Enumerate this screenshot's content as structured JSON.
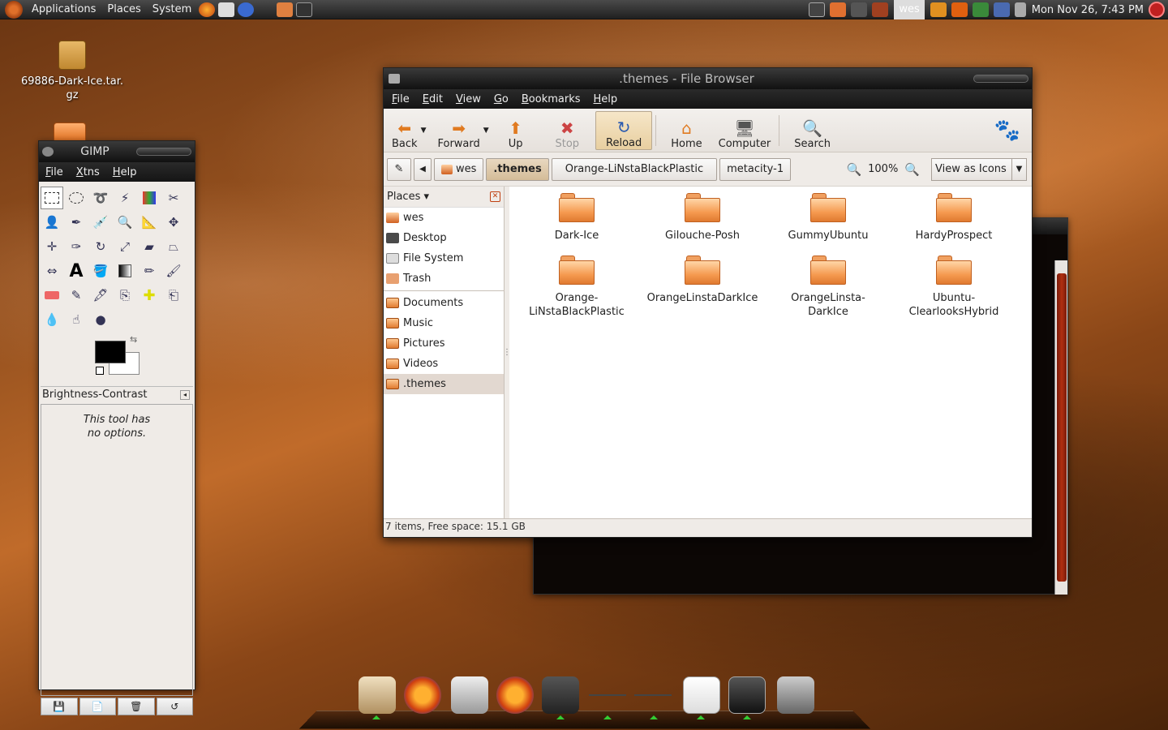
{
  "top_panel": {
    "menus": [
      "Applications",
      "Places",
      "System"
    ],
    "user": "wes",
    "clock": "Mon Nov 26,  7:43 PM"
  },
  "desktop": {
    "icons": [
      {
        "label": "69886-Dark-Ice.tar.\ngz"
      }
    ]
  },
  "gimp": {
    "title": "GIMP",
    "menus": [
      {
        "accel": "F",
        "rest": "ile"
      },
      {
        "accel": "X",
        "rest": "tns"
      },
      {
        "accel": "H",
        "rest": "elp"
      }
    ],
    "tool_options_title": "Brightness-Contrast",
    "tool_options_text_1": "This tool has",
    "tool_options_text_2": "no options.",
    "colors": {
      "foreground": "#000000",
      "background": "#ffffff"
    }
  },
  "file_browser": {
    "title": ".themes - File Browser",
    "menus": [
      {
        "accel": "F",
        "rest": "ile"
      },
      {
        "accel": "E",
        "rest": "dit"
      },
      {
        "accel": "V",
        "rest": "iew"
      },
      {
        "accel": "G",
        "rest": "o"
      },
      {
        "accel": "B",
        "rest": "ookmarks"
      },
      {
        "accel": "H",
        "rest": "elp"
      }
    ],
    "toolbar": {
      "back": "Back",
      "forward": "Forward",
      "up": "Up",
      "stop": "Stop",
      "reload": "Reload",
      "home": "Home",
      "computer": "Computer",
      "search": "Search"
    },
    "path": [
      "wes",
      ".themes",
      "Orange-LiNstaBlackPlastic",
      "metacity-1"
    ],
    "zoom": "100%",
    "view_mode": "View as Icons",
    "sidebar": {
      "header": "Places",
      "items": [
        "wes",
        "Desktop",
        "File System",
        "Trash"
      ],
      "bookmarks": [
        "Documents",
        "Music",
        "Pictures",
        "Videos",
        ".themes"
      ],
      "selected": ".themes"
    },
    "files": [
      {
        "line1": "Dark-Ice",
        "line2": ""
      },
      {
        "line1": "Gilouche-Posh",
        "line2": ""
      },
      {
        "line1": "GummyUbuntu",
        "line2": ""
      },
      {
        "line1": "HardyProspect",
        "line2": ""
      },
      {
        "line1": "Orange-",
        "line2": "LiNstaBlackPlastic"
      },
      {
        "line1": "OrangeLinstaDarkIce",
        "line2": ""
      },
      {
        "line1": "OrangeLinsta-",
        "line2": "DarkIce"
      },
      {
        "line1": "Ubuntu-",
        "line2": "ClearlooksHybrid"
      }
    ],
    "status": "7 items, Free space: 15.1 GB"
  },
  "colors": {
    "panel": "#2a2a2a",
    "folder_orange": "#f59a50",
    "selection": "#e2d8d0"
  }
}
